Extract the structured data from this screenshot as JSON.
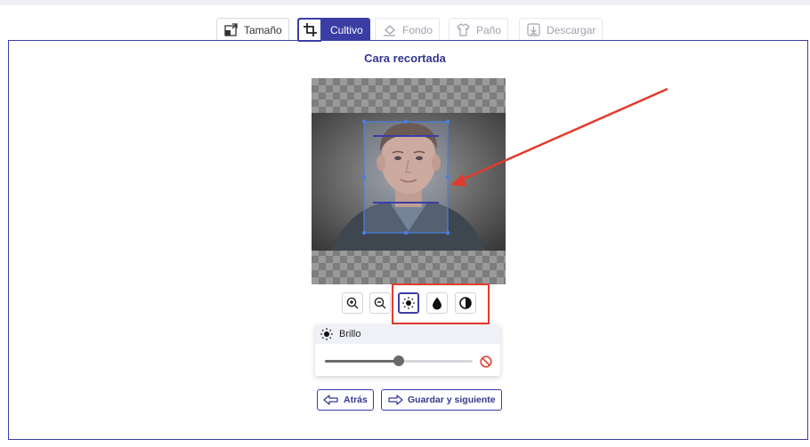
{
  "steps": [
    {
      "label": "Tamaño",
      "icon": "resize-icon",
      "state": "done"
    },
    {
      "label": "Cultivo",
      "icon": "crop-icon",
      "state": "active"
    },
    {
      "label": "Fondo",
      "icon": "background-fill-icon",
      "state": "disabled"
    },
    {
      "label": "Paño",
      "icon": "shirt-icon",
      "state": "disabled"
    },
    {
      "label": "Descargar",
      "icon": "download-icon",
      "state": "disabled"
    }
  ],
  "main": {
    "title": "Cara recortada"
  },
  "tools": [
    {
      "name": "zoom-in",
      "icon": "zoom-in-icon"
    },
    {
      "name": "zoom-out",
      "icon": "zoom-out-icon"
    },
    {
      "name": "brightness",
      "icon": "sun-icon",
      "selected": true
    },
    {
      "name": "saturation",
      "icon": "drop-icon"
    },
    {
      "name": "contrast",
      "icon": "contrast-icon"
    }
  ],
  "adjust": {
    "label": "Brillo",
    "value": 0.5,
    "reset_icon": "reset-icon"
  },
  "nav": {
    "back_label": "Atrás",
    "next_label": "Guardar y siguiente"
  },
  "colors": {
    "accent": "#3b3da5",
    "highlight": "#e23b2d"
  }
}
